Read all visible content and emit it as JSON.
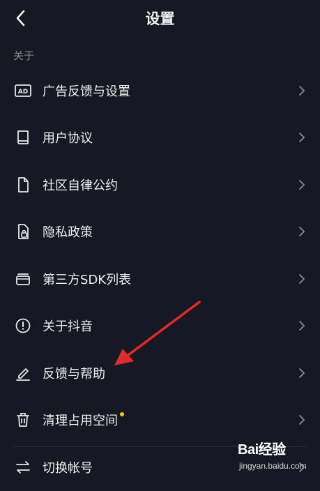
{
  "header": {
    "title": "设置",
    "back_icon": "chevron-left-icon"
  },
  "section_label": "关于",
  "items": [
    {
      "label": "广告反馈与设置",
      "icon": "ad-icon"
    },
    {
      "label": "用户协议",
      "icon": "book-icon"
    },
    {
      "label": "社区自律公约",
      "icon": "document-icon"
    },
    {
      "label": "隐私政策",
      "icon": "privacy-lock-icon"
    },
    {
      "label": "第三方SDK列表",
      "icon": "stack-icon"
    },
    {
      "label": "关于抖音",
      "icon": "info-icon"
    },
    {
      "label": "反馈与帮助",
      "icon": "pen-icon"
    },
    {
      "label": "清理占用空间",
      "icon": "trash-icon",
      "badge_dot": true
    },
    {
      "label": "切换帐号",
      "icon": "switch-icon"
    }
  ],
  "colors": {
    "background": "#161823",
    "badge": "#f5c518",
    "annotation_arrow": "#e02b2b"
  },
  "watermark": {
    "brand": "Bai经验",
    "url": "jingyan.baidu.com"
  }
}
